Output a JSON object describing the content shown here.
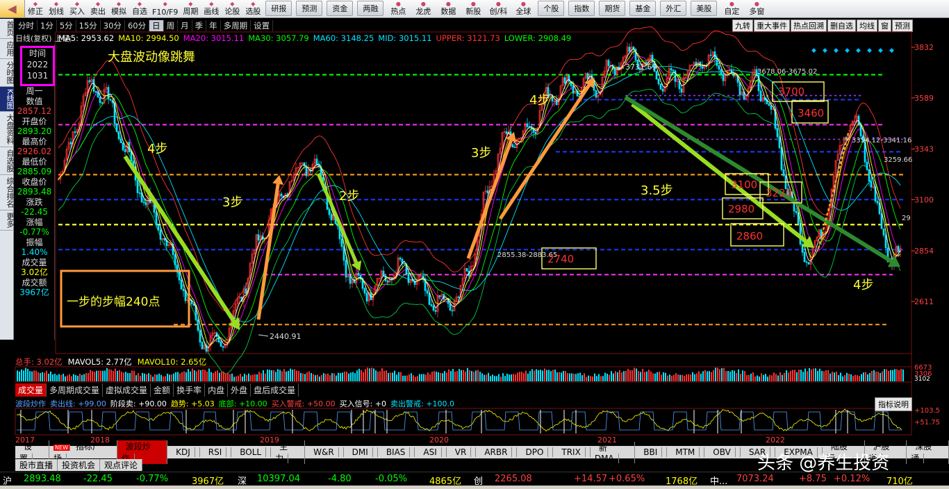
{
  "toolbar": {
    "back_icon": "back-arrow-icon",
    "buttons": [
      "修正",
      "划线",
      "买入",
      "卖出",
      "模拟",
      "自选",
      "F10/F9",
      "周期",
      "画线",
      "论股",
      "选股"
    ],
    "pills": [
      "研报",
      "预测",
      "资金",
      "两融",
      "热点",
      "龙虎",
      "数据",
      "新股",
      "创/科",
      "全球",
      "个股",
      "指数",
      "期货",
      "基金",
      "外汇",
      "美股",
      "自定",
      "多窗"
    ]
  },
  "sidebar": [
    "首页",
    "应用",
    "分时图",
    "K线图",
    "大盘资料",
    "自选股",
    "综合排名",
    "更多"
  ],
  "periods": [
    "分时",
    "1分",
    "5分",
    "15分",
    "30分",
    "60分",
    "日",
    "周",
    "月",
    "季",
    "年",
    "多周期",
    "设置"
  ],
  "active_period": "日",
  "right_tools": [
    "九转",
    "重大事件",
    "热点回溯",
    "删自选",
    "均线",
    "窗",
    "预测"
  ],
  "chart_title": "日线(复权) 上证指数",
  "ma_legend": [
    {
      "text": "MA5: 2953.62",
      "color": "#ffffff"
    },
    {
      "text": "MA10: 2994.50",
      "color": "#ffff00"
    },
    {
      "text": "MA20: 3015.11",
      "color": "#ff00ff"
    },
    {
      "text": "MA30: 3057.79",
      "color": "#00ff00"
    },
    {
      "text": "MA60: 3148.25",
      "color": "#00e5ff"
    },
    {
      "text": "MID: 3015.11",
      "color": "#00e5ff"
    },
    {
      "text": "UPPER: 3121.73",
      "color": "#ff3333"
    },
    {
      "text": "LOWER: 2908.49",
      "color": "#00ff00"
    }
  ],
  "info_panel": {
    "time_label": "时间",
    "date_year": "2022",
    "date_md": "1031",
    "weekday": "周一",
    "value_label": "数值",
    "value": "2857.12",
    "open_label": "开盘价",
    "open": "2893.20",
    "high_label": "最高价",
    "high": "2926.02",
    "low_label": "最低价",
    "low": "2885.09",
    "close_label": "收盘价",
    "close": "2893.48",
    "chg_label": "涨跌",
    "chg": "-22.45",
    "pct_label": "涨幅",
    "pct": "-0.77%",
    "amp_label": "振幅",
    "amp": "1.40%",
    "vol_label": "成交量",
    "vol": "3.02亿",
    "amt_label": "成交额",
    "amt": "3967亿"
  },
  "price_axis": [
    "3832",
    "3589",
    "3343",
    "3100",
    "2854",
    "2611"
  ],
  "annotations": {
    "title": "大盘波动像跳舞",
    "step_box": "一步的步幅240点",
    "steps": [
      "4步",
      "3步",
      "2步",
      "3步",
      "4步",
      "3.5步",
      "4步"
    ],
    "labels": [
      "3731.69",
      "2440.91",
      "2855.38-2883.65",
      "3678.06-3675.02",
      "3354.12-3341.16",
      "3259.66",
      "2740",
      "3700",
      "3460",
      "3100",
      "3220",
      "2980",
      "2860",
      "29"
    ]
  },
  "chart_data": {
    "type": "candlestick",
    "x_years": [
      "2017",
      "2018",
      "2019",
      "2020",
      "2021",
      "2022"
    ],
    "ylim": [
      2440,
      3832
    ],
    "key_points": [
      {
        "x": "2018-01",
        "y": 3587
      },
      {
        "x": "2018-10",
        "y": 2449
      },
      {
        "x": "2019-04",
        "y": 3288
      },
      {
        "x": "2019-08",
        "y": 2733
      },
      {
        "x": "2020-03",
        "y": 2646
      },
      {
        "x": "2020-07",
        "y": 3458
      },
      {
        "x": "2021-02",
        "y": 3731.69
      },
      {
        "x": "2021-12",
        "y": 3708
      },
      {
        "x": "2022-04",
        "y": 2863
      },
      {
        "x": "2022-07",
        "y": 3424
      },
      {
        "x": "2022-10",
        "y": 2885
      }
    ],
    "level_lines": [
      3700,
      3460,
      3220,
      3100,
      2980,
      2860,
      2740,
      2500
    ]
  },
  "volume": {
    "legend": [
      {
        "text": "总手: 3.02亿",
        "color": "#ff4040"
      },
      {
        "text": "MAVOL5: 2.77亿",
        "color": "#ffffff"
      },
      {
        "text": "MAVOL10: 2.65亿",
        "color": "#ffff00"
      }
    ],
    "axis": [
      "6673",
      "3306",
      "3102"
    ],
    "tabs": [
      "成交量",
      "多周期成交量",
      "虚拟成交量",
      "金额",
      "换手率",
      "内盘",
      "外盘",
      "盘后成交量"
    ]
  },
  "wave": {
    "legend": [
      {
        "text": "波段炒作",
        "color": "#5aa0ff"
      },
      {
        "text": "卖出线: +99.00",
        "color": "#5aa0ff"
      },
      {
        "text": "阶段卖: +90.00",
        "color": "#ffffff"
      },
      {
        "text": "趋势: +5.03",
        "color": "#ffff00"
      },
      {
        "text": "底部: +10.00",
        "color": "#00ff00"
      },
      {
        "text": "买入警戒: +50.00",
        "color": "#ff4040"
      },
      {
        "text": "买入信号: +0",
        "color": "#ffffff"
      },
      {
        "text": "卖出警戒: +100.0",
        "color": "#00e5ff"
      }
    ],
    "axis": [
      "+103.5",
      "+51.75"
    ],
    "indicator_btn": "指标说明"
  },
  "ind_tabs": [
    "设置",
    "指标广场",
    "波段炒作",
    "KDJ",
    "RSI",
    "BOLL",
    "主力",
    "W&R",
    "DMI",
    "BIAS",
    "ASI",
    "VR",
    "ARBR",
    "DPO",
    "TRIX",
    "新DMA",
    "BBI",
    "MTM",
    "OBV",
    "SAR",
    "EXPMA",
    "陆股通",
    "沪股通",
    "深股通"
  ],
  "new_badge": "NEW",
  "news": [
    "股市直播",
    "投资机会",
    "观点评论"
  ],
  "ticker": [
    {
      "t": "沪",
      "c": "#ffffff"
    },
    {
      "t": "2893.48",
      "c": "#00ff00"
    },
    {
      "t": "-22.45",
      "c": "#00ff00"
    },
    {
      "t": "-0.77%",
      "c": "#00ff00"
    },
    {
      "t": "3967亿",
      "c": "#ffff00"
    },
    {
      "t": "深",
      "c": "#ffffff"
    },
    {
      "t": "10397.04",
      "c": "#00ff00"
    },
    {
      "t": "-4.80",
      "c": "#00ff00"
    },
    {
      "t": "-0.05%",
      "c": "#00ff00"
    },
    {
      "t": "4865亿",
      "c": "#ffff00"
    },
    {
      "t": "创",
      "c": "#ffffff"
    },
    {
      "t": "2265.08",
      "c": "#ff4040"
    },
    {
      "t": "+14.57",
      "c": "#ff4040"
    },
    {
      "t": "+0.65%",
      "c": "#ff4040"
    },
    {
      "t": "1768亿",
      "c": "#ffff00"
    },
    {
      "t": "中...",
      "c": "#ffffff"
    },
    {
      "t": "7073.24",
      "c": "#ff4040"
    },
    {
      "t": "+8.75",
      "c": "#ff4040"
    },
    {
      "t": "+0.12%",
      "c": "#ff4040"
    },
    {
      "t": "710亿",
      "c": "#ffff00"
    }
  ],
  "watermark": "头条 @养生投资"
}
